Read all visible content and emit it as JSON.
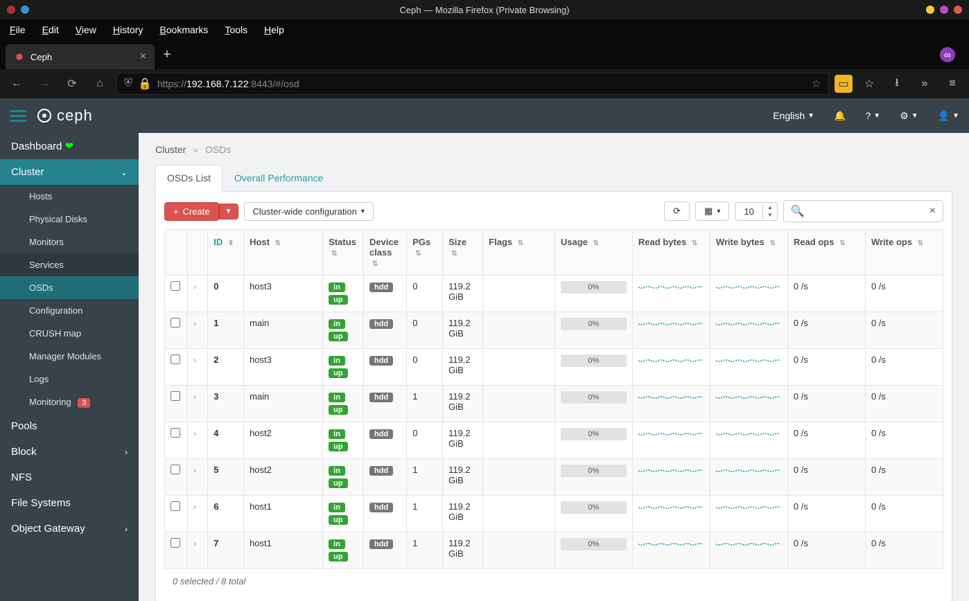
{
  "window": {
    "title": "Ceph — Mozilla Firefox (Private Browsing)"
  },
  "menubar": [
    "File",
    "Edit",
    "View",
    "History",
    "Bookmarks",
    "Tools",
    "Help"
  ],
  "tab": {
    "label": "Ceph"
  },
  "url": {
    "proto": "https://",
    "host": "192.168.7.122",
    "rest": ":8443/#/osd"
  },
  "header": {
    "language": "English"
  },
  "sidebar": {
    "dashboard": "Dashboard",
    "cluster": "Cluster",
    "subs": [
      "Hosts",
      "Physical Disks",
      "Monitors",
      "Services",
      "OSDs",
      "Configuration",
      "CRUSH map",
      "Manager Modules",
      "Logs"
    ],
    "monitoring": "Monitoring",
    "monitoring_badge": "3",
    "rest": [
      "Pools",
      "Block",
      "NFS",
      "File Systems",
      "Object Gateway"
    ]
  },
  "breadcrumb": {
    "a": "Cluster",
    "b": "OSDs"
  },
  "tabs": {
    "a": "OSDs List",
    "b": "Overall Performance"
  },
  "toolbar": {
    "create": "Create",
    "cluster_cfg": "Cluster-wide configuration",
    "page": "10"
  },
  "columns": [
    "ID",
    "Host",
    "Status",
    "Device class",
    "PGs",
    "Size",
    "Flags",
    "Usage",
    "Read bytes",
    "Write bytes",
    "Read ops",
    "Write ops"
  ],
  "rows": [
    {
      "id": "0",
      "host": "host3",
      "status": [
        "in",
        "up"
      ],
      "dev": "hdd",
      "pgs": "0",
      "size": "119.2 GiB",
      "usage": "0%",
      "read": "0 /s",
      "write": "0 /s"
    },
    {
      "id": "1",
      "host": "main",
      "status": [
        "in",
        "up"
      ],
      "dev": "hdd",
      "pgs": "0",
      "size": "119.2 GiB",
      "usage": "0%",
      "read": "0 /s",
      "write": "0 /s"
    },
    {
      "id": "2",
      "host": "host3",
      "status": [
        "in",
        "up"
      ],
      "dev": "hdd",
      "pgs": "0",
      "size": "119.2 GiB",
      "usage": "0%",
      "read": "0 /s",
      "write": "0 /s"
    },
    {
      "id": "3",
      "host": "main",
      "status": [
        "in",
        "up"
      ],
      "dev": "hdd",
      "pgs": "1",
      "size": "119.2 GiB",
      "usage": "0%",
      "read": "0 /s",
      "write": "0 /s"
    },
    {
      "id": "4",
      "host": "host2",
      "status": [
        "in",
        "up"
      ],
      "dev": "hdd",
      "pgs": "0",
      "size": "119.2 GiB",
      "usage": "0%",
      "read": "0 /s",
      "write": "0 /s"
    },
    {
      "id": "5",
      "host": "host2",
      "status": [
        "in",
        "up"
      ],
      "dev": "hdd",
      "pgs": "1",
      "size": "119.2 GiB",
      "usage": "0%",
      "read": "0 /s",
      "write": "0 /s"
    },
    {
      "id": "6",
      "host": "host1",
      "status": [
        "in",
        "up"
      ],
      "dev": "hdd",
      "pgs": "1",
      "size": "119.2 GiB",
      "usage": "0%",
      "read": "0 /s",
      "write": "0 /s"
    },
    {
      "id": "7",
      "host": "host1",
      "status": [
        "in",
        "up"
      ],
      "dev": "hdd",
      "pgs": "1",
      "size": "119.2 GiB",
      "usage": "0%",
      "read": "0 /s",
      "write": "0 /s"
    }
  ],
  "footer": "0 selected / 8 total"
}
